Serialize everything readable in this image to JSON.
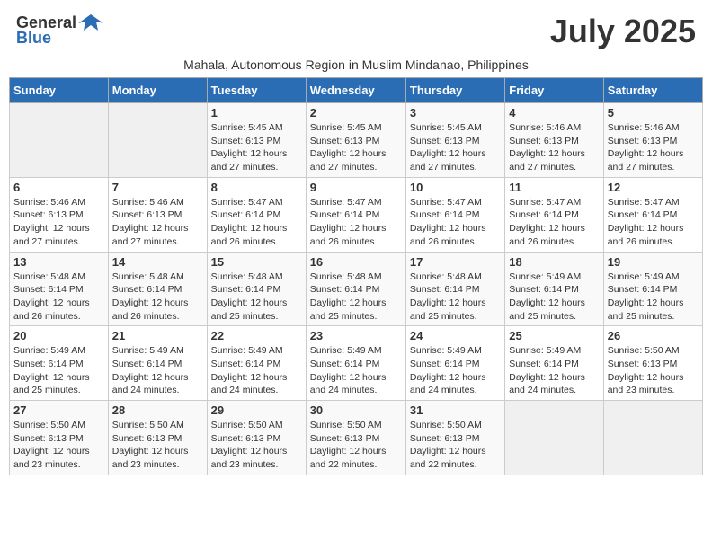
{
  "header": {
    "logo_general": "General",
    "logo_blue": "Blue",
    "title": "July 2025",
    "subtitle": "Mahala, Autonomous Region in Muslim Mindanao, Philippines"
  },
  "days_of_week": [
    "Sunday",
    "Monday",
    "Tuesday",
    "Wednesday",
    "Thursday",
    "Friday",
    "Saturday"
  ],
  "weeks": [
    [
      {
        "day": "",
        "info": ""
      },
      {
        "day": "",
        "info": ""
      },
      {
        "day": "1",
        "info": "Sunrise: 5:45 AM\nSunset: 6:13 PM\nDaylight: 12 hours and 27 minutes."
      },
      {
        "day": "2",
        "info": "Sunrise: 5:45 AM\nSunset: 6:13 PM\nDaylight: 12 hours and 27 minutes."
      },
      {
        "day": "3",
        "info": "Sunrise: 5:45 AM\nSunset: 6:13 PM\nDaylight: 12 hours and 27 minutes."
      },
      {
        "day": "4",
        "info": "Sunrise: 5:46 AM\nSunset: 6:13 PM\nDaylight: 12 hours and 27 minutes."
      },
      {
        "day": "5",
        "info": "Sunrise: 5:46 AM\nSunset: 6:13 PM\nDaylight: 12 hours and 27 minutes."
      }
    ],
    [
      {
        "day": "6",
        "info": "Sunrise: 5:46 AM\nSunset: 6:13 PM\nDaylight: 12 hours and 27 minutes."
      },
      {
        "day": "7",
        "info": "Sunrise: 5:46 AM\nSunset: 6:13 PM\nDaylight: 12 hours and 27 minutes."
      },
      {
        "day": "8",
        "info": "Sunrise: 5:47 AM\nSunset: 6:14 PM\nDaylight: 12 hours and 26 minutes."
      },
      {
        "day": "9",
        "info": "Sunrise: 5:47 AM\nSunset: 6:14 PM\nDaylight: 12 hours and 26 minutes."
      },
      {
        "day": "10",
        "info": "Sunrise: 5:47 AM\nSunset: 6:14 PM\nDaylight: 12 hours and 26 minutes."
      },
      {
        "day": "11",
        "info": "Sunrise: 5:47 AM\nSunset: 6:14 PM\nDaylight: 12 hours and 26 minutes."
      },
      {
        "day": "12",
        "info": "Sunrise: 5:47 AM\nSunset: 6:14 PM\nDaylight: 12 hours and 26 minutes."
      }
    ],
    [
      {
        "day": "13",
        "info": "Sunrise: 5:48 AM\nSunset: 6:14 PM\nDaylight: 12 hours and 26 minutes."
      },
      {
        "day": "14",
        "info": "Sunrise: 5:48 AM\nSunset: 6:14 PM\nDaylight: 12 hours and 26 minutes."
      },
      {
        "day": "15",
        "info": "Sunrise: 5:48 AM\nSunset: 6:14 PM\nDaylight: 12 hours and 25 minutes."
      },
      {
        "day": "16",
        "info": "Sunrise: 5:48 AM\nSunset: 6:14 PM\nDaylight: 12 hours and 25 minutes."
      },
      {
        "day": "17",
        "info": "Sunrise: 5:48 AM\nSunset: 6:14 PM\nDaylight: 12 hours and 25 minutes."
      },
      {
        "day": "18",
        "info": "Sunrise: 5:49 AM\nSunset: 6:14 PM\nDaylight: 12 hours and 25 minutes."
      },
      {
        "day": "19",
        "info": "Sunrise: 5:49 AM\nSunset: 6:14 PM\nDaylight: 12 hours and 25 minutes."
      }
    ],
    [
      {
        "day": "20",
        "info": "Sunrise: 5:49 AM\nSunset: 6:14 PM\nDaylight: 12 hours and 25 minutes."
      },
      {
        "day": "21",
        "info": "Sunrise: 5:49 AM\nSunset: 6:14 PM\nDaylight: 12 hours and 24 minutes."
      },
      {
        "day": "22",
        "info": "Sunrise: 5:49 AM\nSunset: 6:14 PM\nDaylight: 12 hours and 24 minutes."
      },
      {
        "day": "23",
        "info": "Sunrise: 5:49 AM\nSunset: 6:14 PM\nDaylight: 12 hours and 24 minutes."
      },
      {
        "day": "24",
        "info": "Sunrise: 5:49 AM\nSunset: 6:14 PM\nDaylight: 12 hours and 24 minutes."
      },
      {
        "day": "25",
        "info": "Sunrise: 5:49 AM\nSunset: 6:14 PM\nDaylight: 12 hours and 24 minutes."
      },
      {
        "day": "26",
        "info": "Sunrise: 5:50 AM\nSunset: 6:13 PM\nDaylight: 12 hours and 23 minutes."
      }
    ],
    [
      {
        "day": "27",
        "info": "Sunrise: 5:50 AM\nSunset: 6:13 PM\nDaylight: 12 hours and 23 minutes."
      },
      {
        "day": "28",
        "info": "Sunrise: 5:50 AM\nSunset: 6:13 PM\nDaylight: 12 hours and 23 minutes."
      },
      {
        "day": "29",
        "info": "Sunrise: 5:50 AM\nSunset: 6:13 PM\nDaylight: 12 hours and 23 minutes."
      },
      {
        "day": "30",
        "info": "Sunrise: 5:50 AM\nSunset: 6:13 PM\nDaylight: 12 hours and 22 minutes."
      },
      {
        "day": "31",
        "info": "Sunrise: 5:50 AM\nSunset: 6:13 PM\nDaylight: 12 hours and 22 minutes."
      },
      {
        "day": "",
        "info": ""
      },
      {
        "day": "",
        "info": ""
      }
    ]
  ]
}
